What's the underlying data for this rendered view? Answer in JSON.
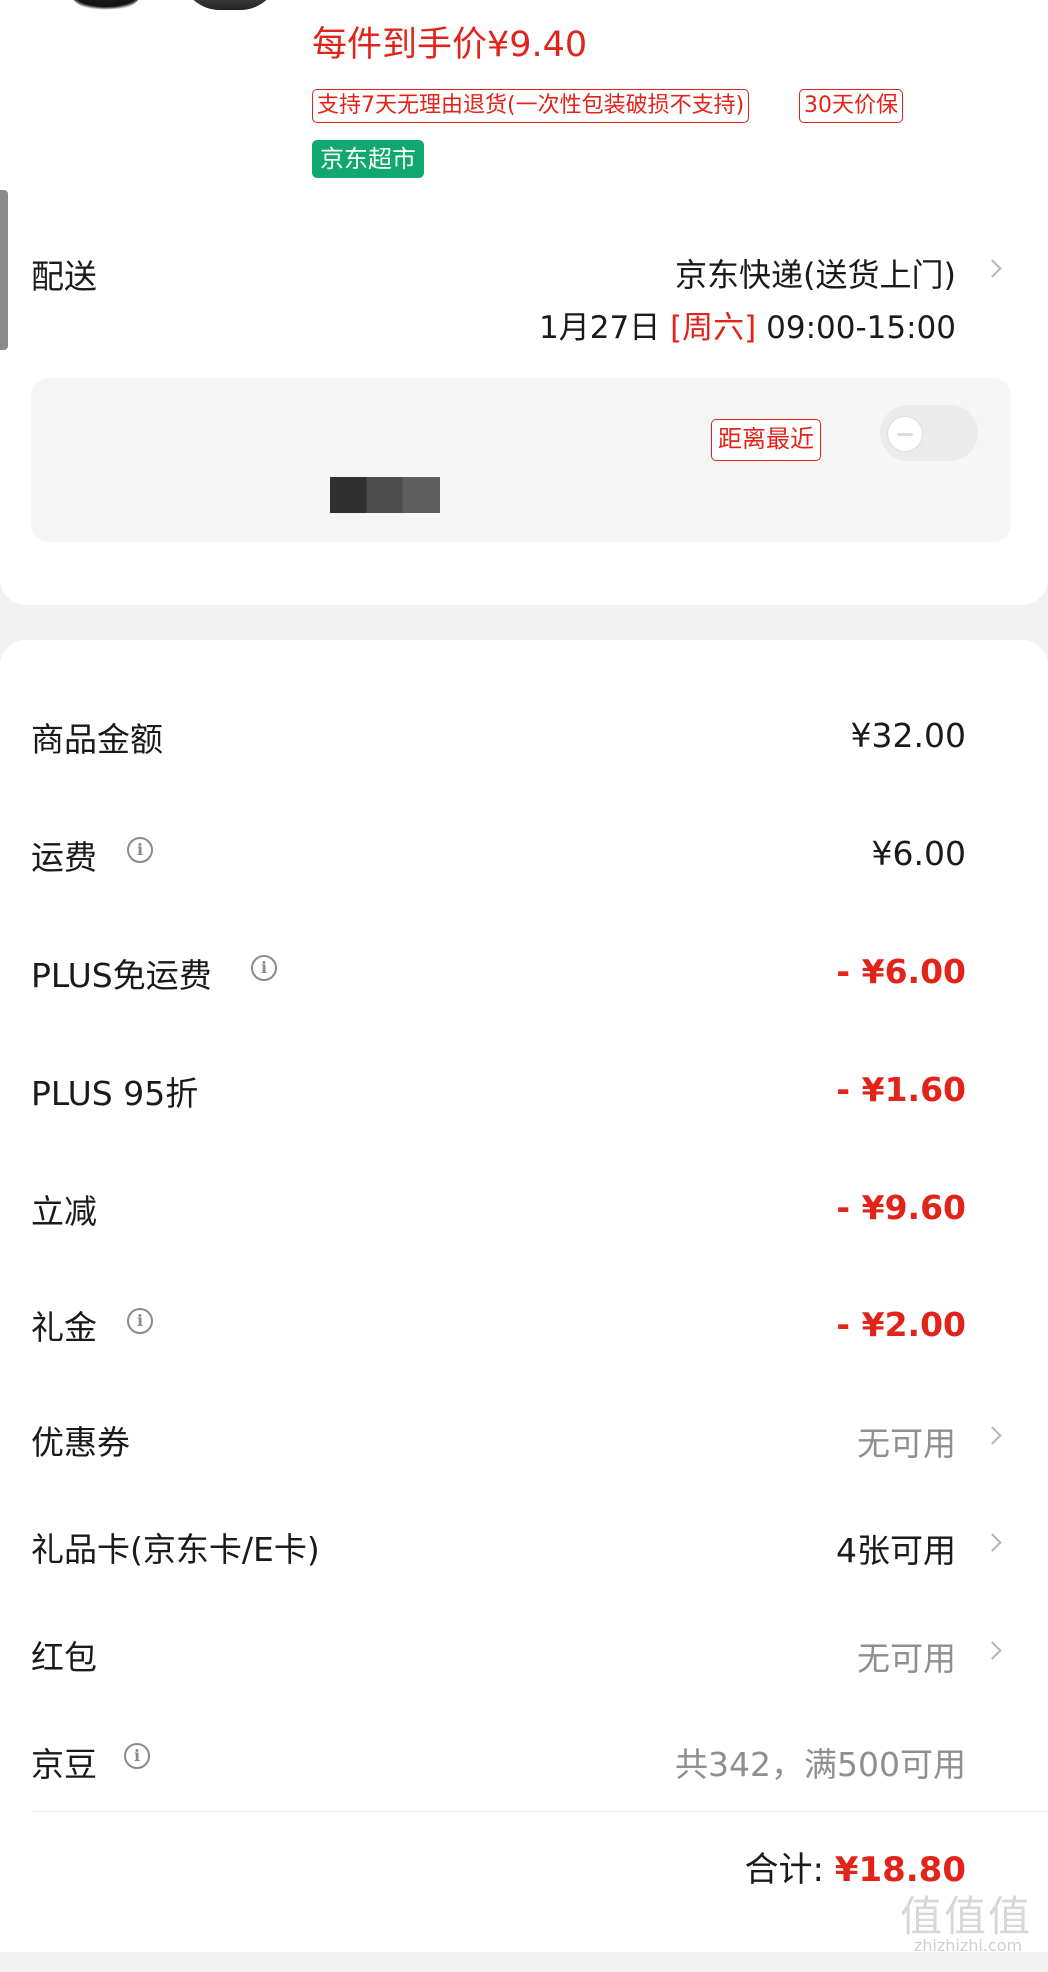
{
  "product": {
    "unit_price": "每件到手价¥9.40",
    "tags": {
      "return": "支持7天无理由退货(一次性包装破损不支持)",
      "price_protect": "30天价保",
      "supermarket": "京东超市"
    }
  },
  "delivery": {
    "label": "配送",
    "method": "京东快递(送货上门)",
    "date": "1月27日",
    "weekday": "[周六]",
    "window": "09:00-15:00",
    "nearest_tag": "距离最近",
    "toggle_on": false
  },
  "pricing": {
    "goods": {
      "label": "商品金额",
      "value": "¥32.00"
    },
    "shipping": {
      "label": "运费",
      "value": "¥6.00"
    },
    "plus_free_shipping": {
      "label": "PLUS免运费",
      "value": "- ¥6.00"
    },
    "plus_discount": {
      "label": "PLUS 95折",
      "value": "- ¥1.60"
    },
    "instant_discount": {
      "label": "立减",
      "value": "- ¥9.60"
    },
    "gift_money": {
      "label": "礼金",
      "value": "- ¥2.00"
    },
    "coupon": {
      "label": "优惠券",
      "value": "无可用"
    },
    "gift_card": {
      "label": "礼品卡(京东卡/E卡)",
      "value": "4张可用"
    },
    "red_packet": {
      "label": "红包",
      "value": "无可用"
    },
    "jd_beans": {
      "label": "京豆",
      "value": "共342，满500可用"
    },
    "total_label": "合计:",
    "total_value": "¥18.80"
  },
  "watermark": {
    "main": "值值值",
    "sub": "zhizhizhi.com"
  },
  "colors": {
    "accent": "#e2231a",
    "supermarket": "#10a870"
  },
  "icons": {
    "info": "info-icon",
    "chevron": "chevron-right-icon"
  }
}
